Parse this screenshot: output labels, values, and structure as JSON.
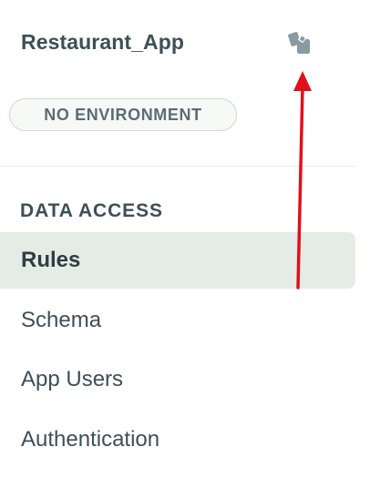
{
  "app": {
    "title": "Restaurant_App",
    "copy_icon": "copy-icon"
  },
  "environment": {
    "label": "NO ENVIRONMENT"
  },
  "nav": {
    "section_title": "DATA ACCESS",
    "items": [
      {
        "label": "Rules",
        "active": true
      },
      {
        "label": "Schema",
        "active": false
      },
      {
        "label": "App Users",
        "active": false
      },
      {
        "label": "Authentication",
        "active": false
      }
    ]
  },
  "annotation": {
    "arrow_color": "#e0101a"
  },
  "colors": {
    "text": "#3d4f58",
    "active_bg": "#e3ede5",
    "pill_border": "#c7dcc9"
  }
}
